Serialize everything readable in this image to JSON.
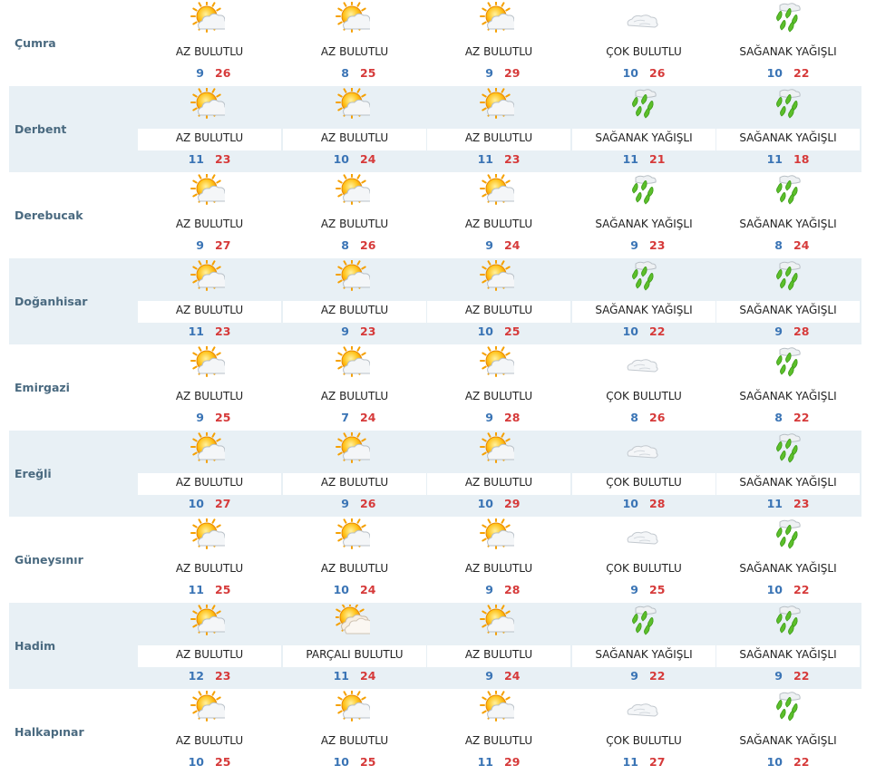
{
  "colors": {
    "min_temp": "#3a74b5",
    "max_temp": "#d63a3a",
    "city": "#4a6a80",
    "row_shade": "#e8f0f5"
  },
  "rows": [
    {
      "city": "Çumra",
      "days": [
        {
          "icon": "partly-sunny-icon",
          "condition": "AZ BULUTLU",
          "min": "9",
          "max": "26"
        },
        {
          "icon": "partly-sunny-icon",
          "condition": "AZ BULUTLU",
          "min": "8",
          "max": "25"
        },
        {
          "icon": "partly-sunny-icon",
          "condition": "AZ BULUTLU",
          "min": "9",
          "max": "29"
        },
        {
          "icon": "cloud-icon",
          "condition": "ÇOK BULUTLU",
          "min": "10",
          "max": "26"
        },
        {
          "icon": "rain-shower-icon",
          "condition": "SAĞANAK YAĞIŞLI",
          "min": "10",
          "max": "22"
        }
      ]
    },
    {
      "city": "Derbent",
      "days": [
        {
          "icon": "partly-sunny-icon",
          "condition": "AZ BULUTLU",
          "min": "11",
          "max": "23"
        },
        {
          "icon": "partly-sunny-icon",
          "condition": "AZ BULUTLU",
          "min": "10",
          "max": "24"
        },
        {
          "icon": "partly-sunny-icon",
          "condition": "AZ BULUTLU",
          "min": "11",
          "max": "23"
        },
        {
          "icon": "rain-shower-icon",
          "condition": "SAĞANAK YAĞIŞLI",
          "min": "11",
          "max": "21"
        },
        {
          "icon": "rain-shower-icon",
          "condition": "SAĞANAK YAĞIŞLI",
          "min": "11",
          "max": "18"
        }
      ]
    },
    {
      "city": "Derebucak",
      "days": [
        {
          "icon": "partly-sunny-icon",
          "condition": "AZ BULUTLU",
          "min": "9",
          "max": "27"
        },
        {
          "icon": "partly-sunny-icon",
          "condition": "AZ BULUTLU",
          "min": "8",
          "max": "26"
        },
        {
          "icon": "partly-sunny-icon",
          "condition": "AZ BULUTLU",
          "min": "9",
          "max": "24"
        },
        {
          "icon": "rain-shower-icon",
          "condition": "SAĞANAK YAĞIŞLI",
          "min": "9",
          "max": "23"
        },
        {
          "icon": "rain-shower-icon",
          "condition": "SAĞANAK YAĞIŞLI",
          "min": "8",
          "max": "24"
        }
      ]
    },
    {
      "city": "Doğanhisar",
      "days": [
        {
          "icon": "partly-sunny-icon",
          "condition": "AZ BULUTLU",
          "min": "11",
          "max": "23"
        },
        {
          "icon": "partly-sunny-icon",
          "condition": "AZ BULUTLU",
          "min": "9",
          "max": "23"
        },
        {
          "icon": "partly-sunny-icon",
          "condition": "AZ BULUTLU",
          "min": "10",
          "max": "25"
        },
        {
          "icon": "rain-shower-icon",
          "condition": "SAĞANAK YAĞIŞLI",
          "min": "10",
          "max": "22"
        },
        {
          "icon": "rain-shower-icon",
          "condition": "SAĞANAK YAĞIŞLI",
          "min": "9",
          "max": "28"
        }
      ]
    },
    {
      "city": "Emirgazi",
      "days": [
        {
          "icon": "partly-sunny-icon",
          "condition": "AZ BULUTLU",
          "min": "9",
          "max": "25"
        },
        {
          "icon": "partly-sunny-icon",
          "condition": "AZ BULUTLU",
          "min": "7",
          "max": "24"
        },
        {
          "icon": "partly-sunny-icon",
          "condition": "AZ BULUTLU",
          "min": "9",
          "max": "28"
        },
        {
          "icon": "cloud-icon",
          "condition": "ÇOK BULUTLU",
          "min": "8",
          "max": "26"
        },
        {
          "icon": "rain-shower-icon",
          "condition": "SAĞANAK YAĞIŞLI",
          "min": "8",
          "max": "22"
        }
      ]
    },
    {
      "city": "Ereğli",
      "days": [
        {
          "icon": "partly-sunny-icon",
          "condition": "AZ BULUTLU",
          "min": "10",
          "max": "27"
        },
        {
          "icon": "partly-sunny-icon",
          "condition": "AZ BULUTLU",
          "min": "9",
          "max": "26"
        },
        {
          "icon": "partly-sunny-icon",
          "condition": "AZ BULUTLU",
          "min": "10",
          "max": "29"
        },
        {
          "icon": "cloud-icon",
          "condition": "ÇOK BULUTLU",
          "min": "10",
          "max": "28"
        },
        {
          "icon": "rain-shower-icon",
          "condition": "SAĞANAK YAĞIŞLI",
          "min": "11",
          "max": "23"
        }
      ]
    },
    {
      "city": "Güneysınır",
      "days": [
        {
          "icon": "partly-sunny-icon",
          "condition": "AZ BULUTLU",
          "min": "11",
          "max": "25"
        },
        {
          "icon": "partly-sunny-icon",
          "condition": "AZ BULUTLU",
          "min": "10",
          "max": "24"
        },
        {
          "icon": "partly-sunny-icon",
          "condition": "AZ BULUTLU",
          "min": "9",
          "max": "28"
        },
        {
          "icon": "cloud-icon",
          "condition": "ÇOK BULUTLU",
          "min": "9",
          "max": "25"
        },
        {
          "icon": "rain-shower-icon",
          "condition": "SAĞANAK YAĞIŞLI",
          "min": "10",
          "max": "22"
        }
      ]
    },
    {
      "city": "Hadim",
      "days": [
        {
          "icon": "partly-sunny-icon",
          "condition": "AZ BULUTLU",
          "min": "12",
          "max": "23"
        },
        {
          "icon": "partly-cloudy-icon",
          "condition": "PARÇALI BULUTLU",
          "min": "11",
          "max": "24"
        },
        {
          "icon": "partly-sunny-icon",
          "condition": "AZ BULUTLU",
          "min": "9",
          "max": "24"
        },
        {
          "icon": "rain-shower-icon",
          "condition": "SAĞANAK YAĞIŞLI",
          "min": "9",
          "max": "22"
        },
        {
          "icon": "rain-shower-icon",
          "condition": "SAĞANAK YAĞIŞLI",
          "min": "9",
          "max": "22"
        }
      ]
    },
    {
      "city": "Halkapınar",
      "days": [
        {
          "icon": "partly-sunny-icon",
          "condition": "AZ BULUTLU",
          "min": "10",
          "max": "25"
        },
        {
          "icon": "partly-sunny-icon",
          "condition": "AZ BULUTLU",
          "min": "10",
          "max": "25"
        },
        {
          "icon": "partly-sunny-icon",
          "condition": "AZ BULUTLU",
          "min": "11",
          "max": "29"
        },
        {
          "icon": "cloud-icon",
          "condition": "ÇOK BULUTLU",
          "min": "11",
          "max": "27"
        },
        {
          "icon": "rain-shower-icon",
          "condition": "SAĞANAK YAĞIŞLI",
          "min": "10",
          "max": "22"
        }
      ]
    }
  ]
}
